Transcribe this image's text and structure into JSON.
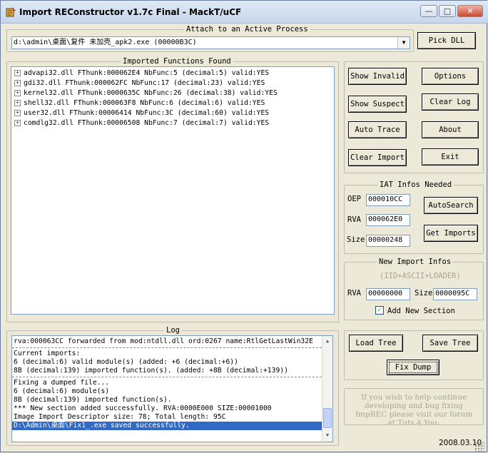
{
  "window": {
    "title": "Import REConstructor v1.7c Final - MackT/uCF",
    "minimize_glyph": "—",
    "maximize_glyph": "□",
    "close_glyph": "✕"
  },
  "attach": {
    "group_title": "Attach to an Active Process",
    "process": "d:\\admin\\桌面\\复件 未加壳_apk2.exe (00000B3C)",
    "pick_dll": "Pick DLL"
  },
  "imports": {
    "group_title": "Imported Functions Found",
    "items": [
      "advapi32.dll FThunk:000062E4 NbFunc:5 (decimal:5) valid:YES",
      "gdi32.dll FThunk:000062FC NbFunc:17 (decimal:23) valid:YES",
      "kernel32.dll FThunk:0000635C NbFunc:26 (decimal:38) valid:YES",
      "shell32.dll FThunk:000063F8 NbFunc:6 (decimal:6) valid:YES",
      "user32.dll FThunk:00006414 NbFunc:3C (decimal:60) valid:YES",
      "comdlg32.dll FThunk:00006508 NbFunc:7 (decimal:7) valid:YES"
    ]
  },
  "buttons": {
    "show_invalid": "Show Invalid",
    "show_suspect": "Show Suspect",
    "auto_trace": "Auto Trace",
    "clear_import": "Clear Import",
    "options": "Options",
    "clear_log": "Clear Log",
    "about": "About",
    "exit": "Exit"
  },
  "iat": {
    "group_title": "IAT Infos Needed",
    "oep_label": "OEP",
    "oep": "000010CC",
    "rva_label": "RVA",
    "rva": "000062E0",
    "size_label": "Size",
    "size": "00000248",
    "autosearch": "AutoSearch",
    "get_imports": "Get Imports"
  },
  "new_import": {
    "group_title": "New Import Infos",
    "subtitle": "(IID+ASCII+LOADER)",
    "rva_label": "RVA",
    "rva": "00000000",
    "size_label": "Size",
    "size": "0000095C",
    "add_section_label": "Add New Section",
    "add_section_checked": "✓"
  },
  "log": {
    "group_title": "Log",
    "lines": [
      {
        "text": "rva:000063CC forwarded from mod:ntdll.dll ord:0267 name:RtlGetLastWin32E",
        "kind": "text"
      },
      {
        "text": "",
        "kind": "sep"
      },
      {
        "text": "Current imports:",
        "kind": "text"
      },
      {
        "text": "6 (decimal:6) valid module(s) (added: +6 (decimal:+6))",
        "kind": "text"
      },
      {
        "text": "8B (decimal:139) imported function(s). (added: +8B (decimal:+139))",
        "kind": "text"
      },
      {
        "text": "",
        "kind": "sep"
      },
      {
        "text": "Fixing a dumped file...",
        "kind": "text"
      },
      {
        "text": "6 (decimal:6) module(s)",
        "kind": "text"
      },
      {
        "text": "8B (decimal:139) imported function(s).",
        "kind": "text"
      },
      {
        "text": "*** New section added successfully. RVA:0000E000 SIZE:00001000",
        "kind": "text"
      },
      {
        "text": "Image Import Descriptor size: 78; Total length: 95C",
        "kind": "text"
      },
      {
        "text": "D:\\Admin\\桌面\\Fix1_.exe saved successfully.",
        "kind": "selected"
      }
    ]
  },
  "tree_buttons": {
    "load_tree": "Load Tree",
    "save_tree": "Save Tree",
    "fix_dump": "Fix Dump"
  },
  "info": {
    "lines": [
      "If you wish to help continue",
      "developing and bug fixing",
      "ImpREC please visit our forum",
      "at Tuts 4 You:"
    ]
  },
  "status": {
    "date": "2008.03.10"
  },
  "colors": {
    "selection": "#3169c6",
    "hint_text": "#a7a497",
    "face": "#ece9d8"
  }
}
